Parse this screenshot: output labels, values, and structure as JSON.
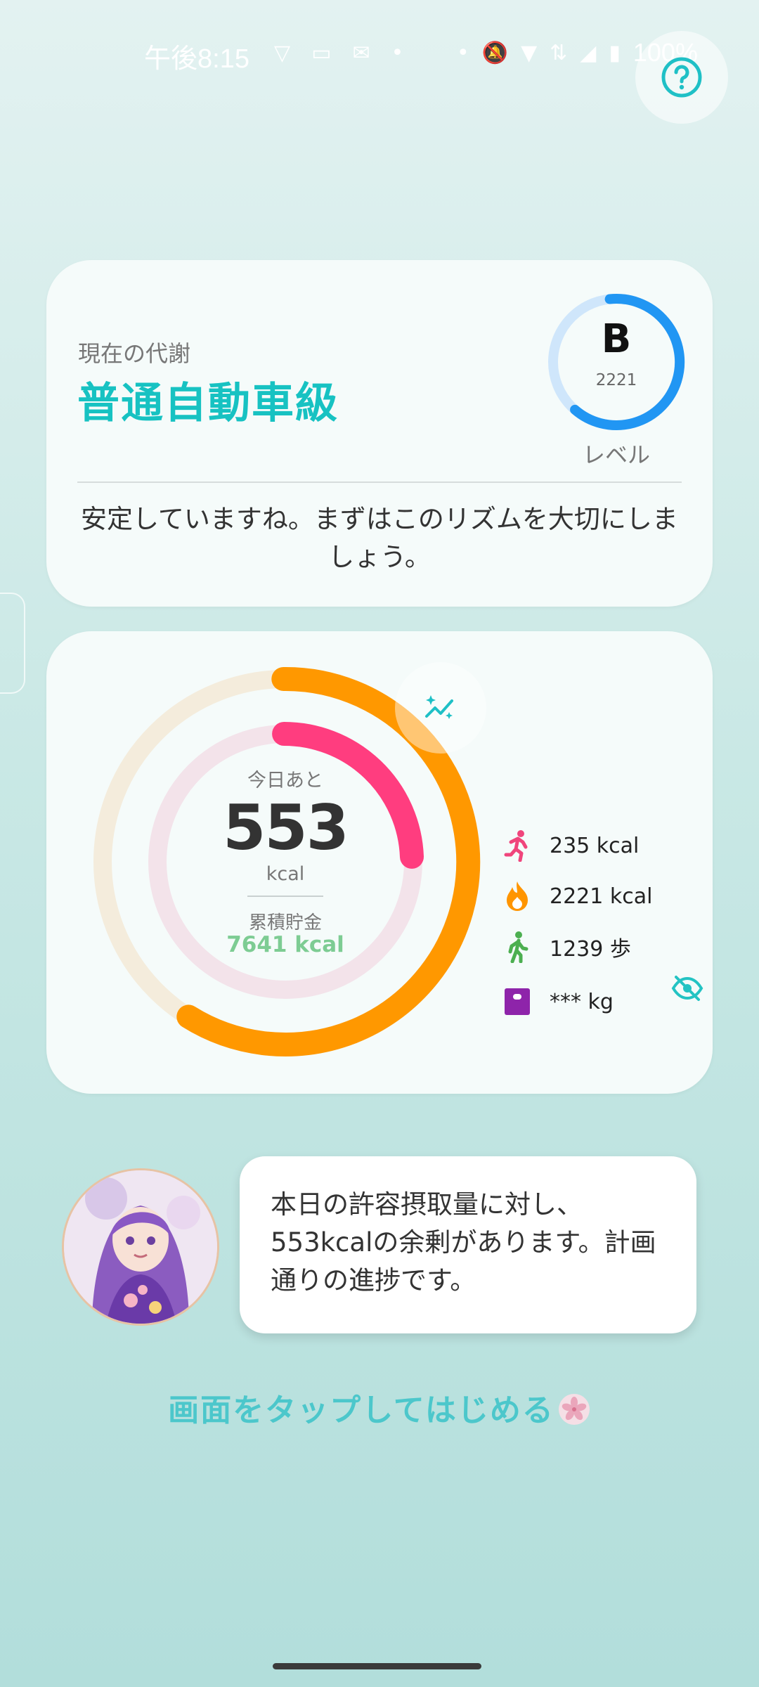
{
  "status_bar": {
    "time": "午後8:15",
    "battery": "100%"
  },
  "metabolism": {
    "label": "現在の代謝",
    "title": "普通自動車級",
    "level_letter": "B",
    "level_value": "2221",
    "level_caption": "レベル",
    "message": "安定していますね。まずはこのリズムを大切にしましょう。",
    "colors": {
      "accent": "#17c2c2",
      "ring": "#2196f3",
      "ring_track": "#cfe6fb"
    }
  },
  "summary": {
    "remaining_label": "今日あと",
    "remaining_value": "553",
    "remaining_unit": "kcal",
    "savings_label": "累積貯金",
    "savings_value": "7641 kcal",
    "stats": [
      {
        "icon": "running-icon",
        "value": "235 kcal",
        "color": "#f0457c"
      },
      {
        "icon": "flame-icon",
        "value": "2221 kcal",
        "color": "#ff9500"
      },
      {
        "icon": "walking-icon",
        "value": "1239 歩",
        "color": "#4caf50"
      },
      {
        "icon": "scale-icon",
        "value": "*** kg",
        "color": "#8e24aa"
      }
    ],
    "colors": {
      "outer": "#ff9800",
      "inner": "#ff3d7f",
      "outer_track": "#f4ecdc",
      "inner_track": "#f3e3ea"
    }
  },
  "assistant": {
    "message": "本日の許容摂取量に対し、553kcalの余剰があります。計画通りの進捗です。"
  },
  "cta": {
    "text": "画面をタップしてはじめる"
  }
}
